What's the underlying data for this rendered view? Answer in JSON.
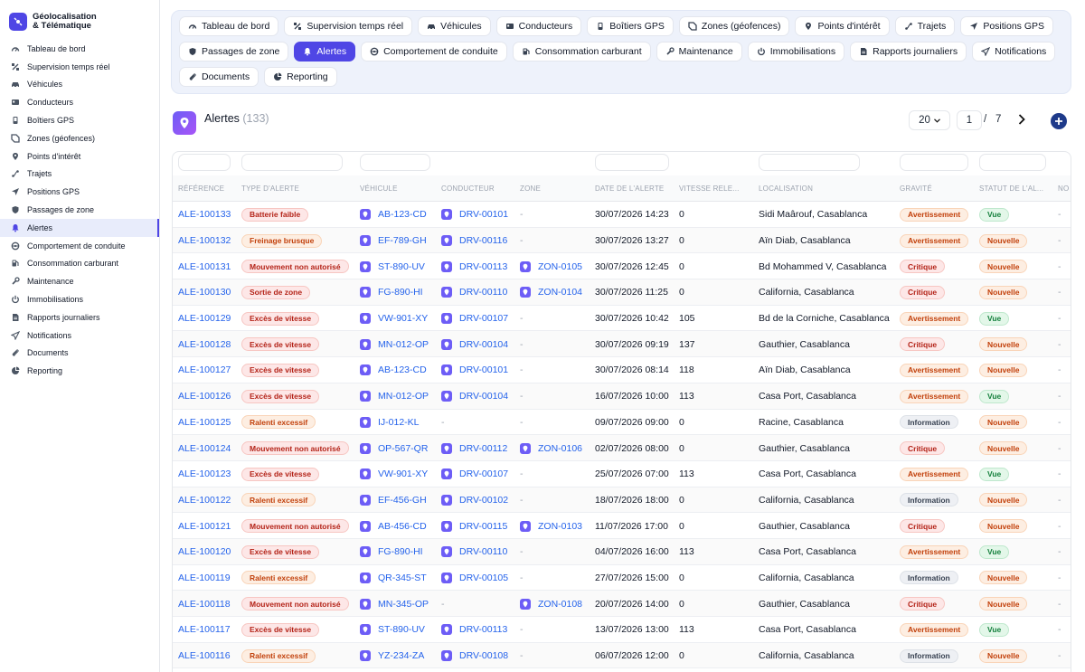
{
  "brand": {
    "line1": "Géolocalisation",
    "line2": "& Télématique"
  },
  "sidebar": {
    "items": [
      {
        "label": "Tableau de bord",
        "icon": "gauge-icon"
      },
      {
        "label": "Supervision temps réel",
        "icon": "satellite-icon"
      },
      {
        "label": "Véhicules",
        "icon": "car-icon"
      },
      {
        "label": "Conducteurs",
        "icon": "id-card-icon"
      },
      {
        "label": "Boîtiers GPS",
        "icon": "device-icon"
      },
      {
        "label": "Zones (géofences)",
        "icon": "geofence-icon"
      },
      {
        "label": "Points d'intérêt",
        "icon": "pin-icon"
      },
      {
        "label": "Trajets",
        "icon": "route-icon"
      },
      {
        "label": "Positions GPS",
        "icon": "location-arrow-icon"
      },
      {
        "label": "Passages de zone",
        "icon": "shield-icon"
      },
      {
        "label": "Alertes",
        "icon": "bell-icon",
        "active": true
      },
      {
        "label": "Comportement de conduite",
        "icon": "steering-icon"
      },
      {
        "label": "Consommation carburant",
        "icon": "fuel-icon"
      },
      {
        "label": "Maintenance",
        "icon": "wrench-icon"
      },
      {
        "label": "Immobilisations",
        "icon": "power-icon"
      },
      {
        "label": "Rapports journaliers",
        "icon": "report-icon"
      },
      {
        "label": "Notifications",
        "icon": "send-icon"
      },
      {
        "label": "Documents",
        "icon": "paperclip-icon"
      },
      {
        "label": "Reporting",
        "icon": "pie-chart-icon"
      }
    ]
  },
  "tabs": [
    {
      "label": "Tableau de bord",
      "icon": "gauge-icon"
    },
    {
      "label": "Supervision temps réel",
      "icon": "satellite-icon"
    },
    {
      "label": "Véhicules",
      "icon": "car-icon"
    },
    {
      "label": "Conducteurs",
      "icon": "id-card-icon"
    },
    {
      "label": "Boîtiers GPS",
      "icon": "device-icon"
    },
    {
      "label": "Zones (géofences)",
      "icon": "geofence-icon"
    },
    {
      "label": "Points d'intérêt",
      "icon": "pin-icon"
    },
    {
      "label": "Trajets",
      "icon": "route-icon"
    },
    {
      "label": "Positions GPS",
      "icon": "location-arrow-icon"
    },
    {
      "label": "Passages de zone",
      "icon": "shield-icon"
    },
    {
      "label": "Alertes",
      "icon": "bell-icon",
      "active": true
    },
    {
      "label": "Comportement de conduite",
      "icon": "steering-icon"
    },
    {
      "label": "Consommation carburant",
      "icon": "fuel-icon"
    },
    {
      "label": "Maintenance",
      "icon": "wrench-icon"
    },
    {
      "label": "Immobilisations",
      "icon": "power-icon"
    },
    {
      "label": "Rapports journaliers",
      "icon": "report-icon"
    },
    {
      "label": "Notifications",
      "icon": "send-icon"
    },
    {
      "label": "Documents",
      "icon": "paperclip-icon"
    },
    {
      "label": "Reporting",
      "icon": "pie-chart-icon"
    }
  ],
  "page": {
    "title": "Alertes",
    "count": "(133)"
  },
  "pagination": {
    "page_size": "20",
    "current": "1",
    "separator": "/",
    "total": "7"
  },
  "colors": {
    "accent": "#4f46e5",
    "link": "#2563eb"
  },
  "table": {
    "columns": [
      "RÉFÉRENCE",
      "TYPE D'ALERTE",
      "VÉHICULE",
      "CONDUCTEUR",
      "ZONE",
      "DATE DE L'ALERTE",
      "VITESSE RELE...",
      "LOCALISATION",
      "GRAVITÉ",
      "STATUT DE L'AL...",
      "NO"
    ],
    "rows": [
      {
        "ref": "ALE-100133",
        "type": "Batterie faible",
        "vehicle": "AB-123-CD",
        "driver": "DRV-00101",
        "zone": "-",
        "date": "30/07/2026 14:23",
        "speed": "0",
        "location": "Sidi Maârouf, Casablanca",
        "severity": "Avertissement",
        "status": "Vue",
        "note": "-"
      },
      {
        "ref": "ALE-100132",
        "type": "Freinage brusque",
        "vehicle": "EF-789-GH",
        "driver": "DRV-00116",
        "zone": "-",
        "date": "30/07/2026 13:27",
        "speed": "0",
        "location": "Aïn Diab, Casablanca",
        "severity": "Avertissement",
        "status": "Nouvelle",
        "note": "-"
      },
      {
        "ref": "ALE-100131",
        "type": "Mouvement non autorisé",
        "vehicle": "ST-890-UV",
        "driver": "DRV-00113",
        "zone": "ZON-0105",
        "date": "30/07/2026 12:45",
        "speed": "0",
        "location": "Bd Mohammed V, Casablanca",
        "severity": "Critique",
        "status": "Nouvelle",
        "note": "-"
      },
      {
        "ref": "ALE-100130",
        "type": "Sortie de zone",
        "vehicle": "FG-890-HI",
        "driver": "DRV-00110",
        "zone": "ZON-0104",
        "date": "30/07/2026 11:25",
        "speed": "0",
        "location": "California, Casablanca",
        "severity": "Critique",
        "status": "Nouvelle",
        "note": "-"
      },
      {
        "ref": "ALE-100129",
        "type": "Excès de vitesse",
        "vehicle": "VW-901-XY",
        "driver": "DRV-00107",
        "zone": "-",
        "date": "30/07/2026 10:42",
        "speed": "105",
        "location": "Bd de la Corniche, Casablanca",
        "severity": "Avertissement",
        "status": "Vue",
        "note": "-"
      },
      {
        "ref": "ALE-100128",
        "type": "Excès de vitesse",
        "vehicle": "MN-012-OP",
        "driver": "DRV-00104",
        "zone": "-",
        "date": "30/07/2026 09:19",
        "speed": "137",
        "location": "Gauthier, Casablanca",
        "severity": "Critique",
        "status": "Nouvelle",
        "note": "-"
      },
      {
        "ref": "ALE-100127",
        "type": "Excès de vitesse",
        "vehicle": "AB-123-CD",
        "driver": "DRV-00101",
        "zone": "-",
        "date": "30/07/2026 08:14",
        "speed": "118",
        "location": "Aïn Diab, Casablanca",
        "severity": "Avertissement",
        "status": "Nouvelle",
        "note": "-"
      },
      {
        "ref": "ALE-100126",
        "type": "Excès de vitesse",
        "vehicle": "MN-012-OP",
        "driver": "DRV-00104",
        "zone": "-",
        "date": "16/07/2026 10:00",
        "speed": "113",
        "location": "Casa Port, Casablanca",
        "severity": "Avertissement",
        "status": "Vue",
        "note": "-"
      },
      {
        "ref": "ALE-100125",
        "type": "Ralenti excessif",
        "vehicle": "IJ-012-KL",
        "driver": "-",
        "zone": "-",
        "date": "09/07/2026 09:00",
        "speed": "0",
        "location": "Racine, Casablanca",
        "severity": "Information",
        "status": "Nouvelle",
        "note": "-"
      },
      {
        "ref": "ALE-100124",
        "type": "Mouvement non autorisé",
        "vehicle": "OP-567-QR",
        "driver": "DRV-00112",
        "zone": "ZON-0106",
        "date": "02/07/2026 08:00",
        "speed": "0",
        "location": "Gauthier, Casablanca",
        "severity": "Critique",
        "status": "Nouvelle",
        "note": "-"
      },
      {
        "ref": "ALE-100123",
        "type": "Excès de vitesse",
        "vehicle": "VW-901-XY",
        "driver": "DRV-00107",
        "zone": "-",
        "date": "25/07/2026 07:00",
        "speed": "113",
        "location": "Casa Port, Casablanca",
        "severity": "Avertissement",
        "status": "Vue",
        "note": "-"
      },
      {
        "ref": "ALE-100122",
        "type": "Ralenti excessif",
        "vehicle": "EF-456-GH",
        "driver": "DRV-00102",
        "zone": "-",
        "date": "18/07/2026 18:00",
        "speed": "0",
        "location": "California, Casablanca",
        "severity": "Information",
        "status": "Nouvelle",
        "note": "-"
      },
      {
        "ref": "ALE-100121",
        "type": "Mouvement non autorisé",
        "vehicle": "AB-456-CD",
        "driver": "DRV-00115",
        "zone": "ZON-0103",
        "date": "11/07/2026 17:00",
        "speed": "0",
        "location": "Gauthier, Casablanca",
        "severity": "Critique",
        "status": "Nouvelle",
        "note": "-"
      },
      {
        "ref": "ALE-100120",
        "type": "Excès de vitesse",
        "vehicle": "FG-890-HI",
        "driver": "DRV-00110",
        "zone": "-",
        "date": "04/07/2026 16:00",
        "speed": "113",
        "location": "Casa Port, Casablanca",
        "severity": "Avertissement",
        "status": "Vue",
        "note": "-"
      },
      {
        "ref": "ALE-100119",
        "type": "Ralenti excessif",
        "vehicle": "QR-345-ST",
        "driver": "DRV-00105",
        "zone": "-",
        "date": "27/07/2026 15:00",
        "speed": "0",
        "location": "California, Casablanca",
        "severity": "Information",
        "status": "Nouvelle",
        "note": "-"
      },
      {
        "ref": "ALE-100118",
        "type": "Mouvement non autorisé",
        "vehicle": "MN-345-OP",
        "driver": "-",
        "zone": "ZON-0108",
        "date": "20/07/2026 14:00",
        "speed": "0",
        "location": "Gauthier, Casablanca",
        "severity": "Critique",
        "status": "Nouvelle",
        "note": "-"
      },
      {
        "ref": "ALE-100117",
        "type": "Excès de vitesse",
        "vehicle": "ST-890-UV",
        "driver": "DRV-00113",
        "zone": "-",
        "date": "13/07/2026 13:00",
        "speed": "113",
        "location": "Casa Port, Casablanca",
        "severity": "Avertissement",
        "status": "Vue",
        "note": "-"
      },
      {
        "ref": "ALE-100116",
        "type": "Ralenti excessif",
        "vehicle": "YZ-234-ZA",
        "driver": "DRV-00108",
        "zone": "-",
        "date": "06/07/2026 12:00",
        "speed": "0",
        "location": "California, Casablanca",
        "severity": "Information",
        "status": "Nouvelle",
        "note": "-"
      }
    ]
  }
}
